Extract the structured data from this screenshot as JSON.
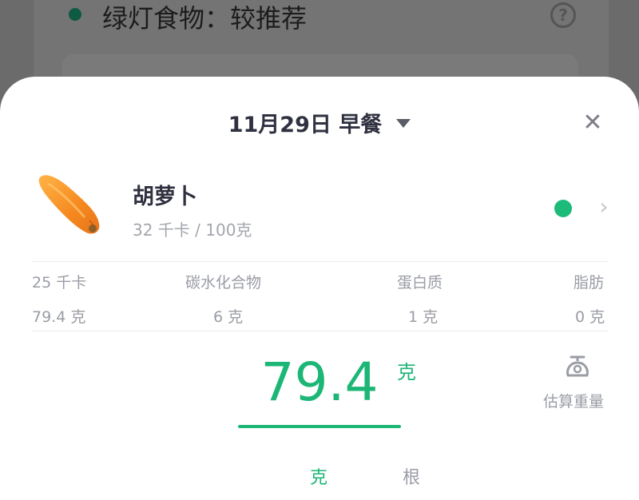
{
  "background": {
    "section_title": "绿灯食物：较推荐",
    "help_icon": "question-circle-icon"
  },
  "header": {
    "title": "11月29日 早餐",
    "dropdown_icon": "caret-down-icon",
    "close_icon": "close-icon"
  },
  "food": {
    "name": "胡萝卜",
    "subtitle": "32 千卡 / 100克",
    "image": "carrot-image",
    "status_color": "#1dbb7a",
    "chevron_icon": "chevron-right-icon"
  },
  "nutrition": {
    "labels": [
      "25 千卡",
      "碳水化合物",
      "蛋白质",
      "脂肪"
    ],
    "values": [
      "79.4 克",
      "6 克",
      "1 克",
      "0 克"
    ]
  },
  "amount": {
    "value": "79.4",
    "unit": "克",
    "estimate_label": "估算重量",
    "estimate_icon": "scale-icon"
  },
  "unit_tabs": [
    "克",
    "根"
  ],
  "colors": {
    "accent": "#1cb676",
    "text_primary": "#2f3140",
    "text_secondary": "#9a9da5"
  }
}
